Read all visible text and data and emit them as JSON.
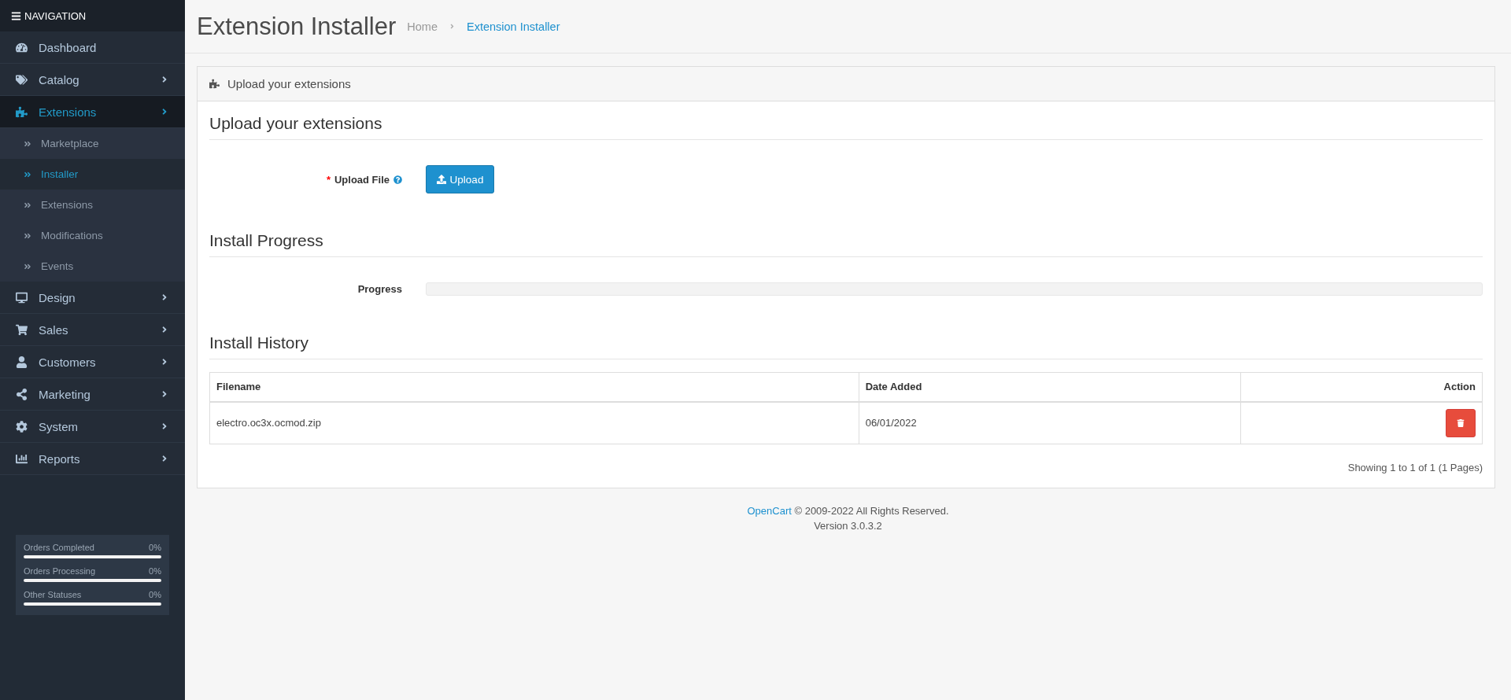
{
  "sidebar": {
    "title": "NAVIGATION",
    "items": [
      {
        "label": "Dashboard",
        "expandable": false,
        "selected": false
      },
      {
        "label": "Catalog",
        "expandable": true,
        "selected": false
      },
      {
        "label": "Extensions",
        "expandable": true,
        "selected": true,
        "children": [
          {
            "label": "Marketplace",
            "selected": false
          },
          {
            "label": "Installer",
            "selected": true
          },
          {
            "label": "Extensions",
            "selected": false
          },
          {
            "label": "Modifications",
            "selected": false
          },
          {
            "label": "Events",
            "selected": false
          }
        ]
      },
      {
        "label": "Design",
        "expandable": true,
        "selected": false
      },
      {
        "label": "Sales",
        "expandable": true,
        "selected": false
      },
      {
        "label": "Customers",
        "expandable": true,
        "selected": false
      },
      {
        "label": "Marketing",
        "expandable": true,
        "selected": false
      },
      {
        "label": "System",
        "expandable": true,
        "selected": false
      },
      {
        "label": "Reports",
        "expandable": true,
        "selected": false
      }
    ],
    "stats": [
      {
        "label": "Orders Completed",
        "value": "0%",
        "level": 0
      },
      {
        "label": "Orders Processing",
        "value": "0%",
        "level": 0
      },
      {
        "label": "Other Statuses",
        "value": "0%",
        "level": 0
      }
    ]
  },
  "page": {
    "title": "Extension Installer",
    "breadcrumb": [
      {
        "label": "Home",
        "selected": false
      },
      {
        "label": "Extension Installer",
        "selected": true
      }
    ]
  },
  "panel": {
    "heading": "Upload your extensions",
    "upload_section": {
      "title": "Upload your extensions",
      "label": "Upload File",
      "required": true,
      "required_mark": "*",
      "button": "Upload"
    },
    "progress_section": {
      "title": "Install Progress",
      "label": "Progress",
      "level": 0
    },
    "history_section": {
      "title": "Install History",
      "columns": [
        "Filename",
        "Date Added",
        "Action"
      ],
      "rows": [
        {
          "filename": "electro.oc3x.ocmod.zip",
          "date": "06/01/2022"
        }
      ],
      "pagination": "Showing 1 to 1 of 1 (1 Pages)"
    }
  },
  "footer": {
    "link": "OpenCart",
    "text": " © 2009-2022 All Rights Reserved.",
    "version": "Version 3.0.3.2"
  }
}
